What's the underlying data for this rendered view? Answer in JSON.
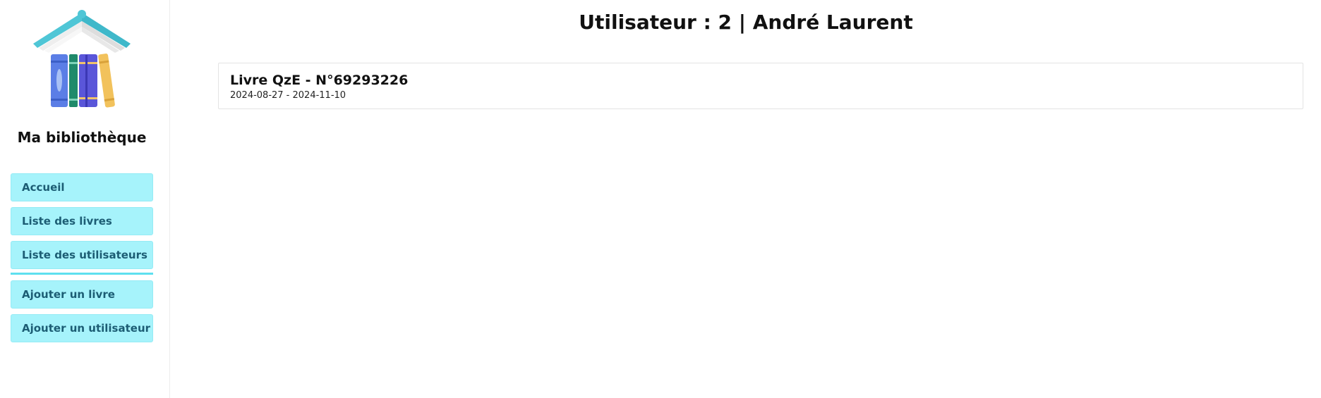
{
  "sidebar": {
    "brand": "Ma bibliothèque",
    "nav_top": [
      {
        "label": "Accueil"
      },
      {
        "label": "Liste des livres"
      },
      {
        "label": "Liste des utilisateurs"
      }
    ],
    "nav_bottom": [
      {
        "label": "Ajouter un livre"
      },
      {
        "label": "Ajouter un utilisateur"
      }
    ]
  },
  "main": {
    "title": "Utilisateur : 2 | André Laurent",
    "loans": [
      {
        "title": "Livre QzE - N°69293226",
        "dates": "2024-08-27 - 2024-11-10"
      }
    ]
  },
  "colors": {
    "nav_bg": "#a6f3fb",
    "nav_text": "#1c5d74",
    "divider": "#5ee0ef"
  },
  "icons": {
    "logo": "book-house-logo-icon"
  }
}
